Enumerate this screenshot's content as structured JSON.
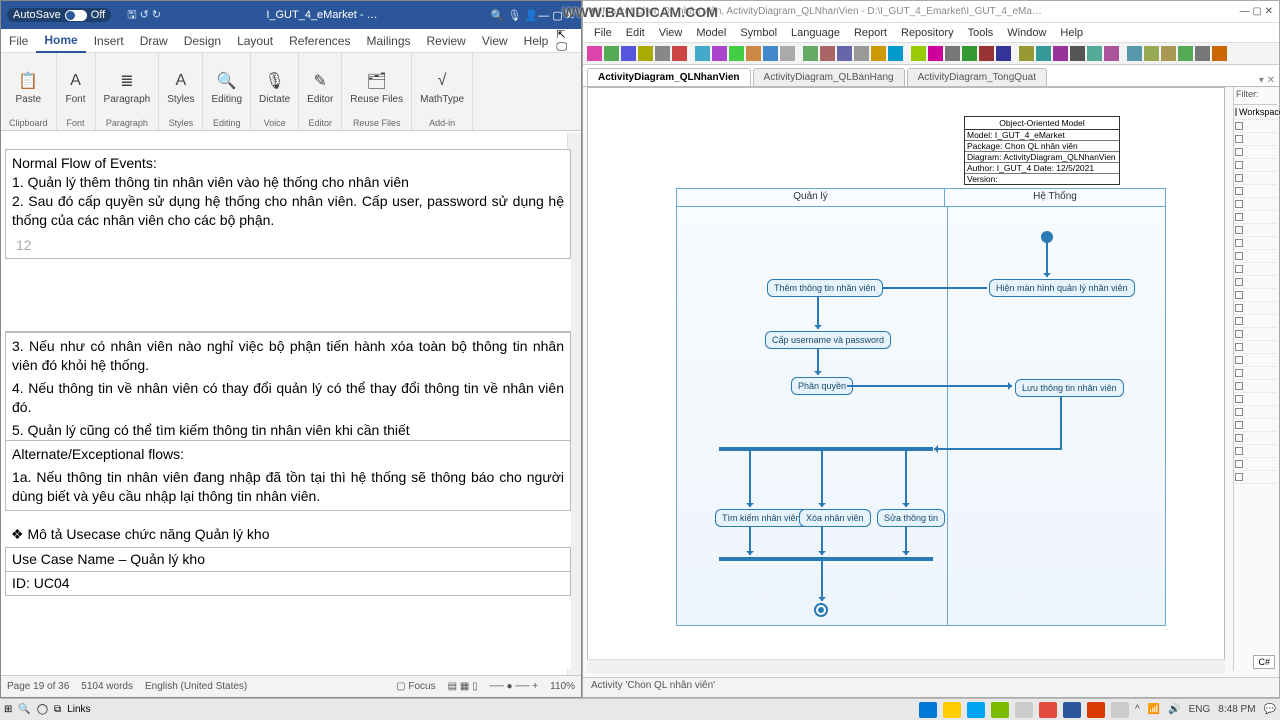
{
  "watermark": "WWW.BANDICAM.COM",
  "word": {
    "autosave_label": "AutoSave",
    "autosave_state": "Off",
    "doc_name": "I_GUT_4_eMarket - …",
    "menu": [
      "File",
      "Home",
      "Insert",
      "Draw",
      "Design",
      "Layout",
      "References",
      "Mailings",
      "Review",
      "View",
      "Help"
    ],
    "active_menu": "Home",
    "ribbon_groups": [
      {
        "label": "Clipboard",
        "items": [
          {
            "glyph": "📋",
            "text": "Paste"
          }
        ]
      },
      {
        "label": "Font",
        "items": [
          {
            "glyph": "A",
            "text": "Font"
          }
        ]
      },
      {
        "label": "Paragraph",
        "items": [
          {
            "glyph": "≣",
            "text": "Paragraph"
          }
        ]
      },
      {
        "label": "Styles",
        "items": [
          {
            "glyph": "A",
            "text": "Styles"
          }
        ]
      },
      {
        "label": "Editing",
        "items": [
          {
            "glyph": "🔍",
            "text": "Editing"
          }
        ]
      },
      {
        "label": "Voice",
        "items": [
          {
            "glyph": "🎙",
            "text": "Dictate"
          }
        ]
      },
      {
        "label": "Editor",
        "items": [
          {
            "glyph": "✎",
            "text": "Editor"
          }
        ]
      },
      {
        "label": "Reuse Files",
        "items": [
          {
            "glyph": "🗂",
            "text": "Reuse Files"
          }
        ]
      },
      {
        "label": "Add-in",
        "items": [
          {
            "glyph": "√",
            "text": "MathType"
          }
        ]
      }
    ],
    "body": {
      "frag1_l1": "Normal Flow of Events:",
      "frag1_l2": "1. Quản lý thêm thông tin nhân viên vào hệ thống cho nhân viên",
      "frag1_l3": "2. Sau đó cấp quyền sử dụng hệ thống cho nhân viên. Cấp user, password sử dụng hệ thống của các nhân viên cho các bộ phận.",
      "page_num": "12",
      "frag2_l1": "3. Nếu như có nhân viên nào nghỉ việc bộ phận tiến hành xóa toàn bộ thông tin nhân viên đó khỏi hệ thống.",
      "frag2_l2": "4. Nếu thông tin về nhân viên có thay đổi quản lý có thể thay đổi thông tin về nhân viên đó.",
      "frag2_l3": "5. Quản lý cũng có thể tìm kiếm thông tin nhân viên khi cần thiết",
      "frag2_l4": "Alternate/Exceptional flows:",
      "frag2_l5": "1a. Nếu thông tin nhân viên đang nhập đã tồn tại thì hệ thống sẽ thông báo cho người dùng biết và yêu cầu nhập lại thông tin nhân viên.",
      "frag3_head": "❖ Mô tả Usecase chức năng Quản lý kho",
      "frag3_row1": "Use Case Name – Quản lý kho",
      "frag3_row2": "ID: UC04"
    },
    "status": {
      "page": "Page 19 of 36",
      "words": "5104 words",
      "lang": "English (United States)",
      "focus": "Focus",
      "zoom": "110%"
    }
  },
  "pd": {
    "title": "eMarket:Chon QL nhân viên, ActivityDiagram_QLNhanVien - D:\\I_GUT_4_Emarket\\I_GUT_4_eMa…",
    "menu": [
      "File",
      "Edit",
      "View",
      "Model",
      "Symbol",
      "Language",
      "Report",
      "Repository",
      "Tools",
      "Window",
      "Help"
    ],
    "tabs": [
      "ActivityDiagram_QLNhanVien",
      "ActivityDiagram_QLBanHang",
      "ActivityDiagram_TongQuat"
    ],
    "active_tab": 0,
    "filter_label": "Filter:",
    "browser_root": "Workspace",
    "model_info_title": "Object-Oriented Model",
    "model_info": [
      "Model: I_GUT_4_eMarket",
      "Package: Chon QL nhân viên",
      "Diagram: ActivityDiagram_QLNhanVien",
      "Author: I_GUT_4        Date: 12/5/2021",
      "Version:"
    ],
    "lanes": [
      "Quản lý",
      "Hệ Thống"
    ],
    "acts": {
      "a1": "Thêm thông tin nhân viên",
      "a2": "Cấp username và password",
      "a3": "Phân quyền",
      "a4": "Hiện màn hình quản lý nhân viên",
      "a5": "Lưu thông tin nhân viên",
      "a6": "Tìm kiếm nhân viên",
      "a7": "Xóa nhân viên",
      "a8": "Sửa thông tin"
    },
    "status": "Activity 'Chon QL nhân viên'",
    "lang_btn": "C#"
  },
  "taskbar": {
    "links": "Links",
    "lang": "ENG",
    "time": "8:48 PM"
  }
}
